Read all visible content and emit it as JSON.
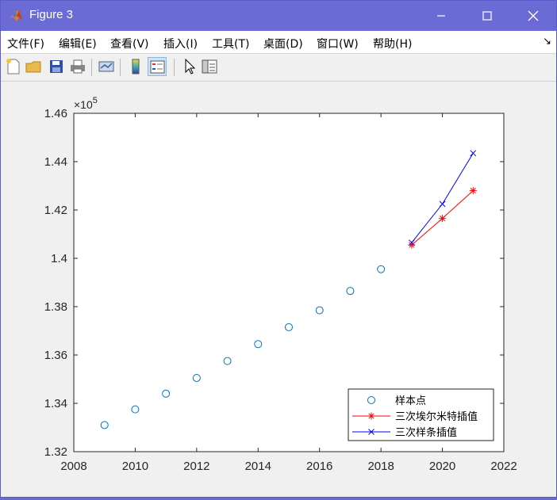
{
  "window": {
    "title": "Figure 3"
  },
  "menu": {
    "items": [
      "文件(F)",
      "编辑(E)",
      "查看(V)",
      "插入(I)",
      "工具(T)",
      "桌面(D)",
      "窗口(W)",
      "帮助(H)"
    ]
  },
  "toolbar": {
    "buttons": [
      "new-figure",
      "open-file",
      "save",
      "print",
      "link-plot",
      "insert-colorbar",
      "insert-legend",
      "pointer",
      "property-inspector"
    ]
  },
  "chart_data": {
    "type": "line",
    "exponent_label": "×10",
    "exponent_power": "5",
    "exponent": 100000,
    "xlim": [
      2008,
      2022
    ],
    "ylim": [
      132000,
      146000
    ],
    "x_ticks": [
      "2008",
      "2010",
      "2012",
      "2014",
      "2016",
      "2018",
      "2020",
      "2022"
    ],
    "y_ticks": [
      "1.32",
      "1.34",
      "1.36",
      "1.38",
      "1.4",
      "1.42",
      "1.44",
      "1.46"
    ],
    "series": [
      {
        "name": "样本点",
        "marker": "circle",
        "line": false,
        "color": "#0072BD",
        "x": [
          2009,
          2010,
          2011,
          2012,
          2013,
          2014,
          2015,
          2016,
          2017,
          2018
        ],
        "y": [
          133100,
          133750,
          134400,
          135050,
          135750,
          136450,
          137150,
          137850,
          138650,
          139550
        ]
      },
      {
        "name": "三次埃尔米特插值",
        "marker": "asterisk",
        "line": true,
        "color": "#FF0000",
        "x": [
          2019,
          2020,
          2021
        ],
        "y": [
          140550,
          141650,
          142800
        ]
      },
      {
        "name": "三次样条插值",
        "marker": "x",
        "line": true,
        "color": "#0000FF",
        "x": [
          2019,
          2020,
          2021
        ],
        "y": [
          140650,
          142250,
          144350
        ]
      }
    ],
    "legend_position": "bottom-right",
    "grid": false
  }
}
